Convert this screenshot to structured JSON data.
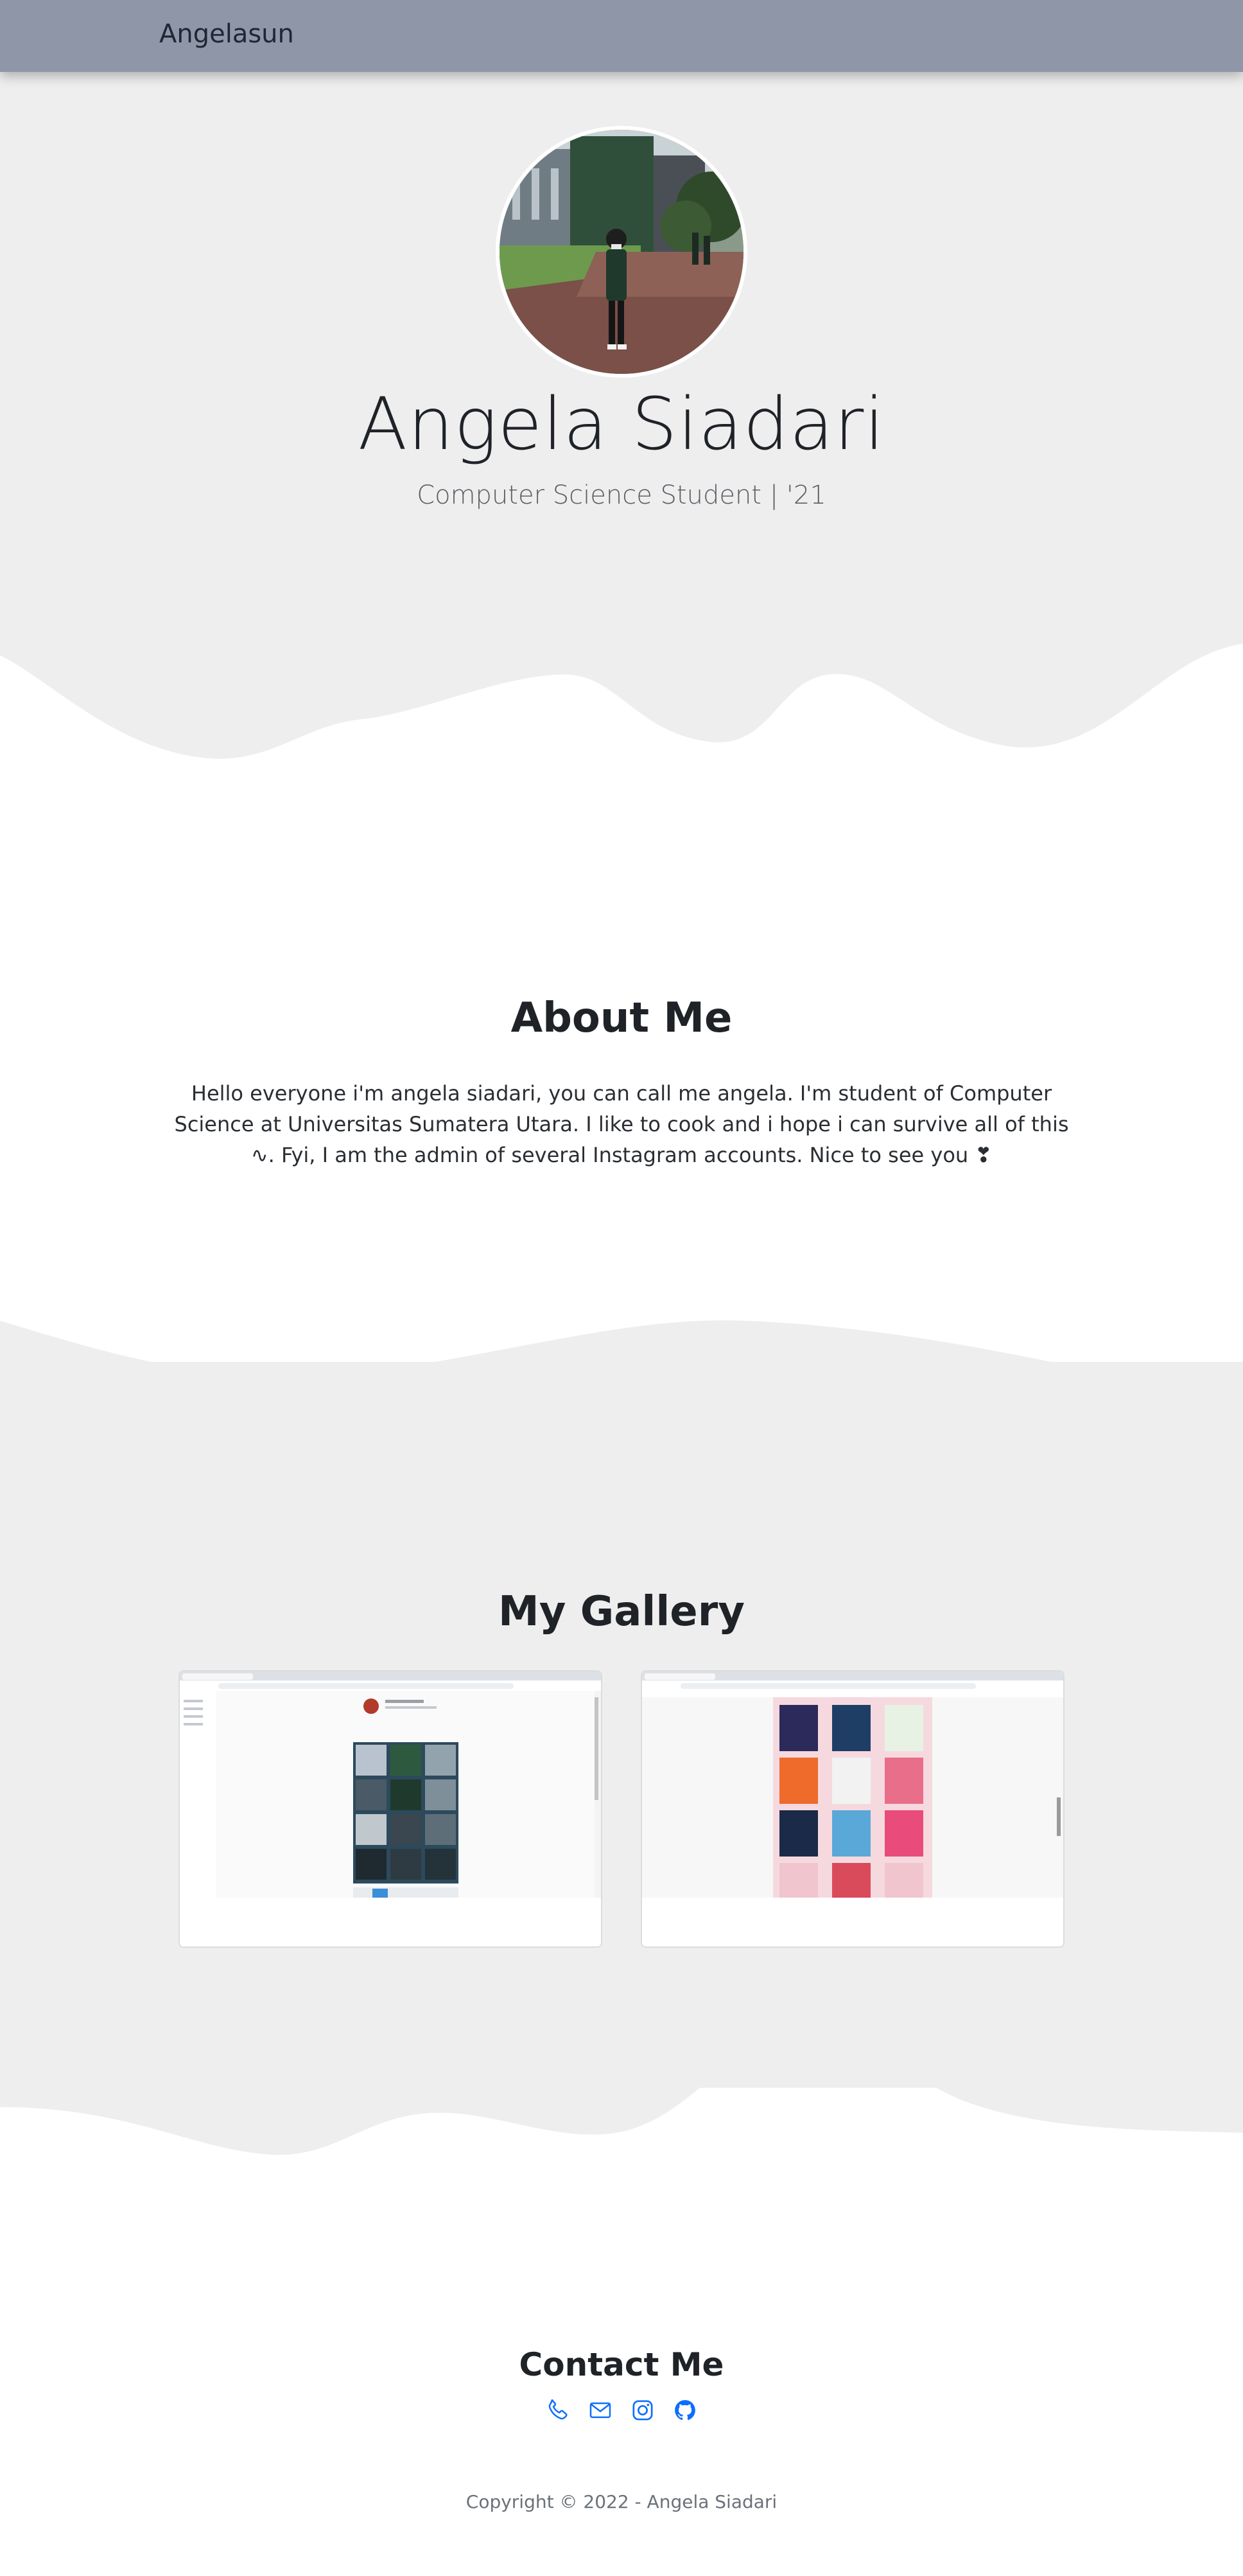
{
  "navbar": {
    "brand": "Angelasun"
  },
  "hero": {
    "name": "Angela Siadari",
    "subtitle": "Computer Science Student | '21",
    "avatar_icon": "profile-photo"
  },
  "about": {
    "title": "About Me",
    "text": "Hello everyone i'm angela siadari, you can call me angela. I'm student of Computer Science at Universitas Sumatera Utara. I like to cook and i hope i can survive all of this ∿. Fyi, I am the admin of several Instagram accounts. Nice to see you ❣"
  },
  "gallery": {
    "title": "My Gallery",
    "items": [
      {
        "image_icon": "instagram-profile-screenshot"
      },
      {
        "image_icon": "instagram-posters-screenshot"
      }
    ]
  },
  "contact": {
    "title": "Contact Me",
    "icons": [
      "phone-icon",
      "envelope-icon",
      "instagram-icon",
      "github-icon"
    ],
    "icon_color": "#0d6efd"
  },
  "footer": {
    "copyright": "Copyright © 2022 - Angela Siadari"
  },
  "colors": {
    "navbar": "#8f96a8",
    "section_gray": "#eeeeee",
    "background": "#ffffff"
  }
}
